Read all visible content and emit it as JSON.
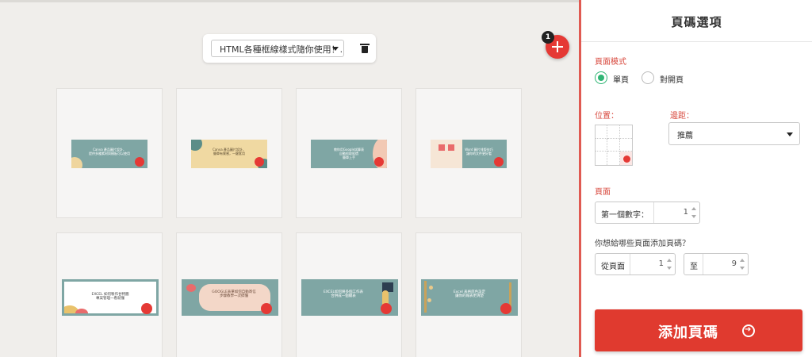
{
  "workspace": {
    "file_name": "HTML各種框線樣式隨你使用！.p",
    "add_badge_count": "1",
    "pages": [
      {
        "bg": "#7fa6a4",
        "text": "Canva 產品圖片設計，\n提供多種素材與模板可以使用",
        "accent": "#efd59d"
      },
      {
        "bg": "#f0d9a2",
        "text": "Canva 產品圖片設計，\n簡單有質感，一鍵套用",
        "accent": "#5b8d88"
      },
      {
        "bg": "#7fa6a4",
        "text": "教你用Google試算表\n自動抓取股價\n簡單上手",
        "accent": "#f2c9b4"
      },
      {
        "bg": "#7fa6a4",
        "text": "Word 圖片排版技巧\n讓你的文件更好看",
        "accent": "#f6e6d6"
      },
      {
        "bg": "#ffffff",
        "text": "EXCEL 如何製作甘特圖\n專案管理一看就懂",
        "accent": "#7fa6a4"
      },
      {
        "bg": "#f3d7c8",
        "text": "GOOGLE表單如何自動寄信\n步驟教學一次搞懂",
        "accent": "#7fa6a4"
      },
      {
        "bg": "#7fa6a4",
        "text": "EXCEL如何將多個工作表\n合併成一個總表",
        "accent": "#e9c26b"
      },
      {
        "bg": "#7fa6a4",
        "text": "Excel 表格底色設定\n讓你的報表更清楚",
        "accent": "#eac98a"
      }
    ]
  },
  "panel": {
    "title": "頁碼選項",
    "page_mode_label": "頁面模式",
    "radio_single": "單頁",
    "radio_facing": "對開頁",
    "position_label": "位置：",
    "margin_label": "邊距：",
    "margin_value": "推薦",
    "pages_label": "頁面",
    "first_number_label": "第一個數字：",
    "first_number_value": "1",
    "which_pages_label": "你想給哪些頁面添加頁碼？",
    "from_label": "從頁面",
    "from_value": "1",
    "to_label": "至",
    "to_value": "9",
    "submit_label": "添加頁碼"
  },
  "colors": {
    "accent_red": "#e53935",
    "radio_green": "#2fb574"
  }
}
